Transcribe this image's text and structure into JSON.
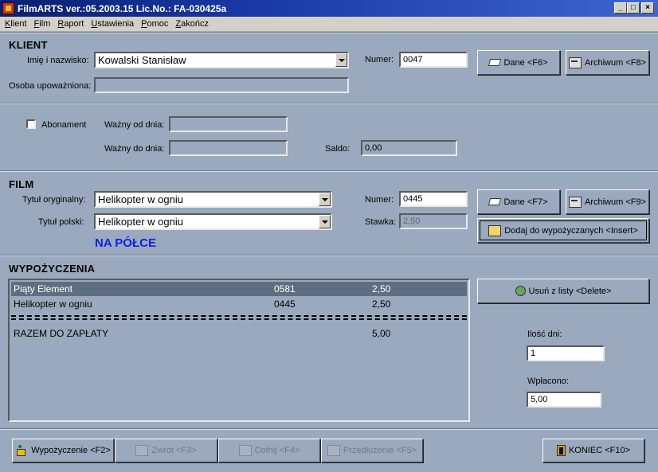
{
  "window": {
    "title": "FilmARTS  ver.:05.2003.15  Lic.No.: FA-030425a"
  },
  "menu": [
    "Klient",
    "Film",
    "Raport",
    "Ustawienia",
    "Pomoc",
    "Zakończ"
  ],
  "klient": {
    "title": "KLIENT",
    "name_label": "Imię i nazwisko:",
    "name_value": "Kowalski Stanisław",
    "numer_label": "Numer:",
    "numer_value": "0047",
    "osoba_label": "Osoba upoważniona:",
    "osoba_value": "",
    "dane_button": "Dane <F6>",
    "archiwum_button": "Archiwum <F8>"
  },
  "abonament": {
    "checkbox_label": "Abonament",
    "wazny_od_label": "Ważny od dnia:",
    "wazny_od_value": "",
    "wazny_do_label": "Ważny do dnia:",
    "wazny_do_value": "",
    "saldo_label": "Saldo:",
    "saldo_value": "0,00"
  },
  "film": {
    "title": "FILM",
    "tytul_oryg_label": "Tytuł oryginalny:",
    "tytul_oryg_value": "Helikopter w ogniu",
    "tytul_pl_label": "Tytuł polski:",
    "tytul_pl_value": "Helikopter w ogniu",
    "numer_label": "Numer:",
    "numer_value": "0445",
    "stawka_label": "Stawka:",
    "stawka_value": "2,50",
    "status": "NA PÓŁCE",
    "status_color": "#0b22e8",
    "dane_button": "Dane <F7>",
    "archiwum_button": "Archiwum <F9>",
    "dodaj_button": "Dodaj do wypożyczanych <Insert>"
  },
  "wypozyczenia": {
    "title": "WYPOŻYCZENIA",
    "rows": [
      {
        "title": "Piąty Element",
        "numer": "0581",
        "stawka": "2,50"
      },
      {
        "title": "Helikopter w ogniu",
        "numer": "0445",
        "stawka": "2,50"
      }
    ],
    "total_label": "RAZEM DO ZAPŁATY",
    "total_value": "5,00",
    "usun_button": "Usuń z listy <Delete>",
    "ilosc_dni_label": "Ilość dni:",
    "ilosc_dni_value": "1",
    "wplacono_label": "Wpłacono:",
    "wplacono_value": "5,00"
  },
  "toolbar": {
    "wypozyczenie": "Wypożyczenie <F2>",
    "zwrot": "Zwrot <F3>",
    "cofnij": "Cofnij <F4>",
    "przedluzenie": "Przedłużenie <F5>",
    "koniec": "KONIEC <F10>"
  }
}
